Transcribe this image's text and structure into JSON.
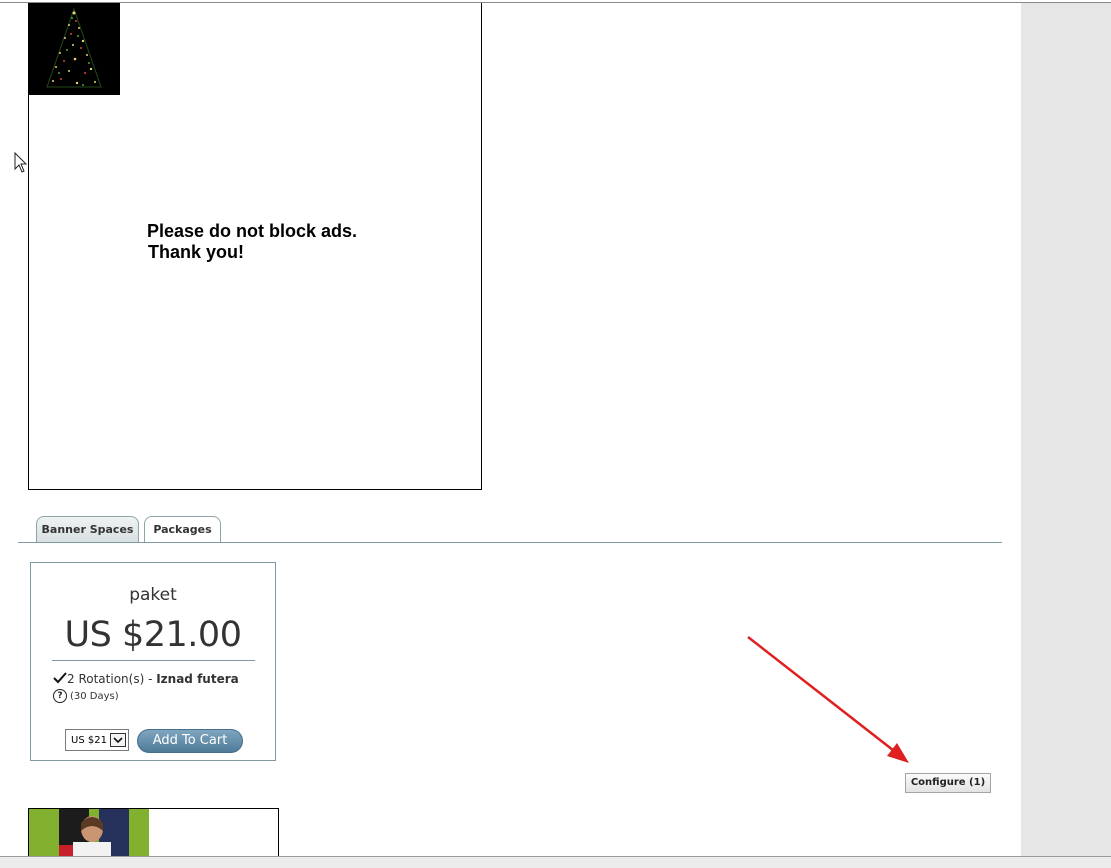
{
  "ad_banner": {
    "message_line1": "Please do not block ads.",
    "message_line2": "Thank you!",
    "thumbnail_icon": "christmas-tree-image"
  },
  "tabs": [
    {
      "label": "Banner Spaces",
      "active": false
    },
    {
      "label": "Packages",
      "active": true
    }
  ],
  "package": {
    "name": "paket",
    "price": "US $21.00",
    "rotations": "2 Rotation(s) - ",
    "location": "Iznad futera",
    "duration": "(30 Days)",
    "select_value": "US $21",
    "add_to_cart_label": "Add To Cart"
  },
  "configure_label": "Configure (1)",
  "colors": {
    "accent_button": "#5a87a6",
    "annotation_arrow": "#e02020",
    "gutter": "#e6e6e6"
  }
}
